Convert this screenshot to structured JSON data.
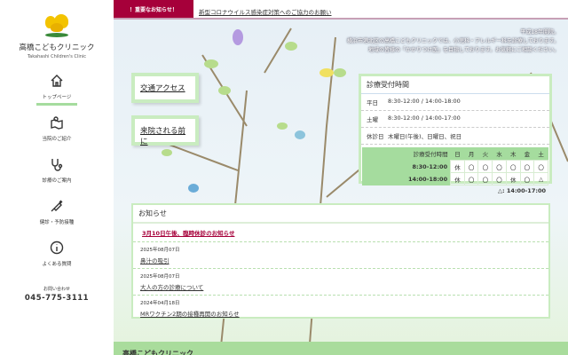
{
  "sidebar": {
    "brand": "高橋こどもクリニック",
    "brand_en": "Takahashi Children's Clinic",
    "items": [
      {
        "label": "トップページ"
      },
      {
        "label": "当院のご紹介"
      },
      {
        "label": "診療のご案内"
      },
      {
        "label": "健診・予防接種"
      },
      {
        "label": "よくある質問"
      }
    ],
    "contact_label": "お問い合わせ",
    "phone": "045-775-3111"
  },
  "alert": {
    "label": "！重要なお知らせ！",
    "text": "新型コロナウイルス感染症対策へのご協力のお願い"
  },
  "intro": [
    "平成18年開院。",
    "横浜市港北区の高橋こどもクリニックでは、小児科・アレルギー科を診療しております。",
    "地域の皆様の「かかりつけ医」を目指しております。お気軽にご相談ください。"
  ],
  "buttons": {
    "access": "交通アクセス",
    "before": "来院される前に"
  },
  "hours": {
    "title": "診療受付時間",
    "rows": [
      {
        "k": "平日",
        "v": "8:30-12:00 / 14:00-18:00"
      },
      {
        "k": "土曜",
        "v": "8:30-12:00 / 14:00-17:00"
      },
      {
        "k": "休診日",
        "v": "木曜日(午後)、日曜日、祝日"
      }
    ],
    "table": {
      "header": [
        "診療受付時間",
        "日",
        "月",
        "火",
        "水",
        "木",
        "金",
        "土"
      ],
      "rows": [
        [
          "8:30-12:00",
          "休",
          "〇",
          "〇",
          "〇",
          "〇",
          "〇",
          "〇"
        ],
        [
          "14:00-18:00",
          "休",
          "〇",
          "〇",
          "〇",
          "休",
          "〇",
          "△"
        ]
      ]
    },
    "note": "△: 14:00-17:00"
  },
  "news": {
    "title": "お知らせ",
    "top": "3月10日午後、臨時休診のお知らせ",
    "items": [
      {
        "date": "2025年08月07日",
        "title": "鼻汁の吸引"
      },
      {
        "date": "2025年08月07日",
        "title": "大人の方の診療について"
      },
      {
        "date": "2024年04月18日",
        "title": "MRワクチン2期の接種再開のお知らせ"
      }
    ]
  },
  "footer": {
    "title": "高橋こどもクリニック"
  }
}
